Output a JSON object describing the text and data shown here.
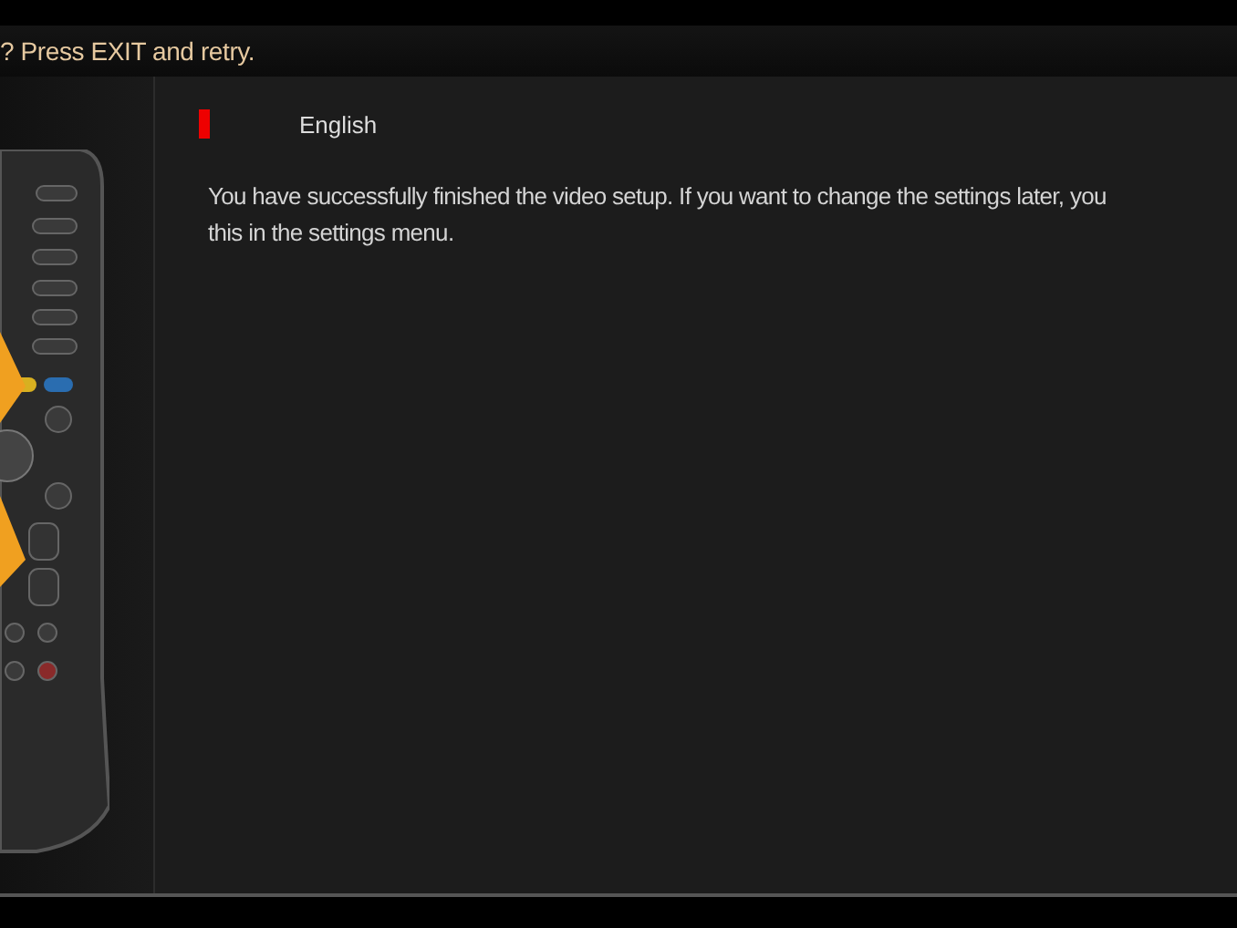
{
  "header": {
    "title": "? Press EXIT and retry."
  },
  "language": {
    "label": "English",
    "selected": true
  },
  "message": {
    "lines": [
      "You have successfully finished the video setup. If you want to change the settings later, you",
      "this in the settings menu."
    ]
  }
}
